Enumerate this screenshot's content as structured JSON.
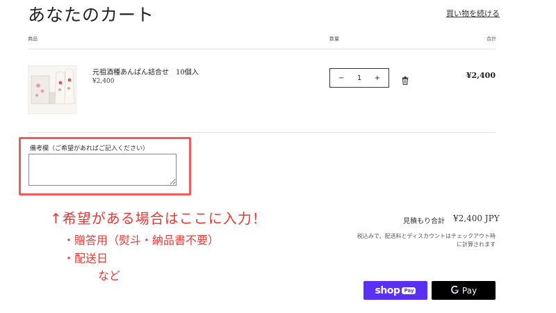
{
  "header": {
    "title": "あなたのカート",
    "continue_link": "買い物を続ける"
  },
  "table": {
    "col_product": "商品",
    "col_quantity": "数量",
    "col_total": "合計"
  },
  "item": {
    "name": "元祖酒種あんぱん詰合せ　10個入",
    "price": "¥2,400",
    "quantity": "1",
    "line_total": "¥2,400",
    "image_icon": "product-photo-icon"
  },
  "controls": {
    "minus": "−",
    "plus": "+",
    "delete_icon": "trash-icon"
  },
  "note": {
    "label": "備考欄（ご希望があればご記入ください）",
    "value": ""
  },
  "annotation": {
    "main": "↑希望がある場合はここに入力！",
    "line1": "・贈答用（熨斗・納品書不要）",
    "line2": "・配送日",
    "line3": "など",
    "color": "#e53935"
  },
  "summary": {
    "subtotal_label": "見積もり合計",
    "subtotal_value": "¥2,400 JPY",
    "tax_note_line1": "税込みで、配送料とディスカウントはチェックアウト時",
    "tax_note_line2": "に計算されます"
  },
  "payments": {
    "shop_pay_word": "shop",
    "shop_pay_pill": "Pay",
    "shop_pay_color": "#5a31f4",
    "gpay_g": "G",
    "gpay_word": "Pay"
  }
}
